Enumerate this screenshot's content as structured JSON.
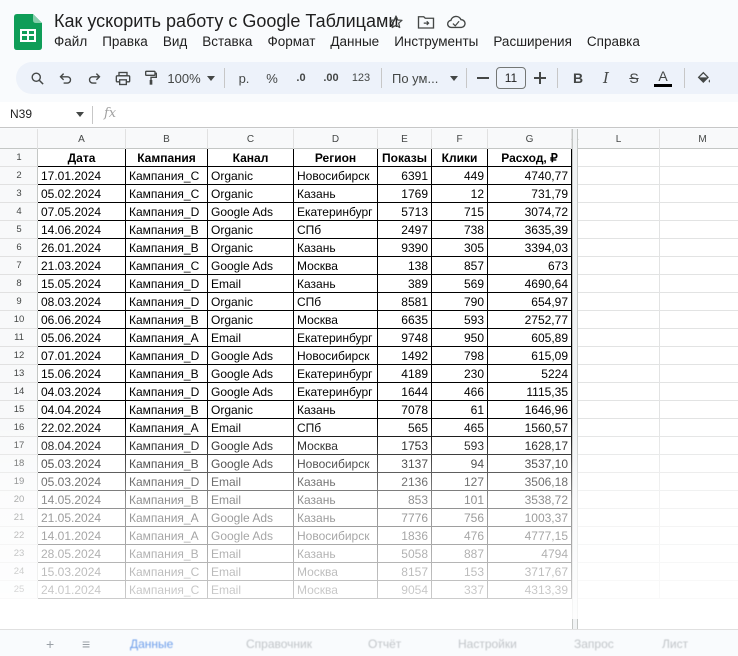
{
  "app": {
    "title": "Как ускорить работу с Google Таблицами",
    "menu": [
      "Файл",
      "Правка",
      "Вид",
      "Вставка",
      "Формат",
      "Данные",
      "Инструменты",
      "Расширения",
      "Справка"
    ]
  },
  "toolbar": {
    "zoom": "100%",
    "currency": "р.",
    "percent": "%",
    "dec_decrease": ".0",
    "dec_increase": ".00",
    "number_format": "123",
    "font": "По ум...",
    "font_size": "11",
    "bold": "B",
    "italic": "I",
    "strike": "S",
    "text_color": "A"
  },
  "formula_bar": {
    "name_box": "N39",
    "fx": "fx"
  },
  "columns": [
    "A",
    "B",
    "C",
    "D",
    "E",
    "F",
    "G",
    "L",
    "M"
  ],
  "headers": [
    "Дата",
    "Кампания",
    "Канал",
    "Регион",
    "Показы",
    "Клики",
    "Расход, ₽"
  ],
  "rows": [
    [
      "17.01.2024",
      "Кампания_C",
      "Organic",
      "Новосибирск",
      "6391",
      "449",
      "4740,77"
    ],
    [
      "05.02.2024",
      "Кампания_C",
      "Organic",
      "Казань",
      "1769",
      "12",
      "731,79"
    ],
    [
      "07.05.2024",
      "Кампания_D",
      "Google Ads",
      "Екатеринбург",
      "5713",
      "715",
      "3074,72"
    ],
    [
      "14.06.2024",
      "Кампания_B",
      "Organic",
      "СПб",
      "2497",
      "738",
      "3635,39"
    ],
    [
      "26.01.2024",
      "Кампания_B",
      "Organic",
      "Казань",
      "9390",
      "305",
      "3394,03"
    ],
    [
      "21.03.2024",
      "Кампания_C",
      "Google Ads",
      "Москва",
      "138",
      "857",
      "673"
    ],
    [
      "15.05.2024",
      "Кампания_D",
      "Email",
      "Казань",
      "389",
      "569",
      "4690,64"
    ],
    [
      "08.03.2024",
      "Кампания_D",
      "Organic",
      "СПб",
      "8581",
      "790",
      "654,97"
    ],
    [
      "06.06.2024",
      "Кампания_B",
      "Organic",
      "Москва",
      "6635",
      "593",
      "2752,77"
    ],
    [
      "05.06.2024",
      "Кампания_A",
      "Email",
      "Екатеринбург",
      "9748",
      "950",
      "605,89"
    ],
    [
      "07.01.2024",
      "Кампания_D",
      "Google Ads",
      "Новосибирск",
      "1492",
      "798",
      "615,09"
    ],
    [
      "15.06.2024",
      "Кампания_B",
      "Google Ads",
      "Екатеринбург",
      "4189",
      "230",
      "5224"
    ],
    [
      "04.03.2024",
      "Кампания_D",
      "Google Ads",
      "Екатеринбург",
      "1644",
      "466",
      "1115,35"
    ],
    [
      "04.04.2024",
      "Кампания_B",
      "Organic",
      "Казань",
      "7078",
      "61",
      "1646,96"
    ],
    [
      "22.02.2024",
      "Кампания_A",
      "Email",
      "СПб",
      "565",
      "465",
      "1560,57"
    ],
    [
      "08.04.2024",
      "Кампания_D",
      "Google Ads",
      "Москва",
      "1753",
      "593",
      "1628,17"
    ],
    [
      "05.03.2024",
      "Кампания_B",
      "Google Ads",
      "Новосибирск",
      "3137",
      "94",
      "3537,10"
    ],
    [
      "05.03.2024",
      "Кампания_D",
      "Email",
      "Казань",
      "2136",
      "127",
      "3506,18"
    ],
    [
      "14.05.2024",
      "Кампания_B",
      "Email",
      "Казань",
      "853",
      "101",
      "3538,72"
    ],
    [
      "21.05.2024",
      "Кампания_A",
      "Google Ads",
      "Казань",
      "7776",
      "756",
      "1003,37"
    ],
    [
      "14.01.2024",
      "Кампания_A",
      "Google Ads",
      "Новосибирск",
      "1836",
      "476",
      "4777,15"
    ],
    [
      "28.05.2024",
      "Кампания_B",
      "Email",
      "Казань",
      "5058",
      "887",
      "4794"
    ],
    [
      "15.03.2024",
      "Кампания_C",
      "Email",
      "Москва",
      "8157",
      "153",
      "3717,67"
    ],
    [
      "24.01.2024",
      "Кампания_C",
      "Email",
      "Москва",
      "9054",
      "337",
      "4313,39"
    ]
  ],
  "sheet_tabs": [
    "Данные",
    "Справочник",
    "Отчёт",
    "Настройки",
    "Запрос",
    "Лист"
  ]
}
